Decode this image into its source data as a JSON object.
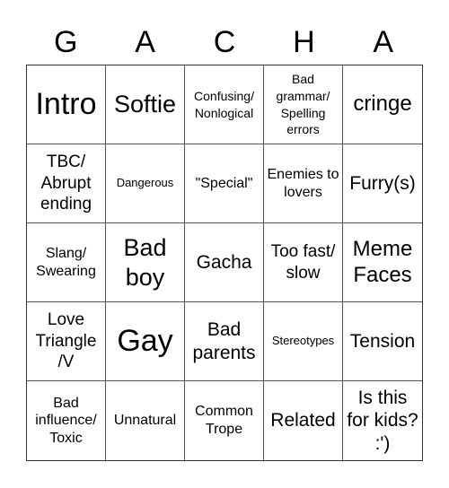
{
  "title_letters": [
    "G",
    "A",
    "C",
    "H",
    "A"
  ],
  "cells": [
    [
      "Intro",
      "Softie",
      "Confusing/ Nonlogical",
      "Bad grammar/ Spelling errors",
      "cringe"
    ],
    [
      "TBC/ Abrupt ending",
      "Dangerous",
      "\"Special\"",
      "Enemies to lovers",
      "Furry(s)"
    ],
    [
      "Slang/ Swearing",
      "Bad boy",
      "Gacha",
      "Too fast/ slow",
      "Meme Faces"
    ],
    [
      "Love Triangle /V",
      "Gay",
      "Bad parents",
      "Stereotypes",
      "Tension"
    ],
    [
      "Bad influence/ Toxic",
      "Unnatural",
      "Common Trope",
      "Related",
      "Is this for kids? :')"
    ]
  ]
}
